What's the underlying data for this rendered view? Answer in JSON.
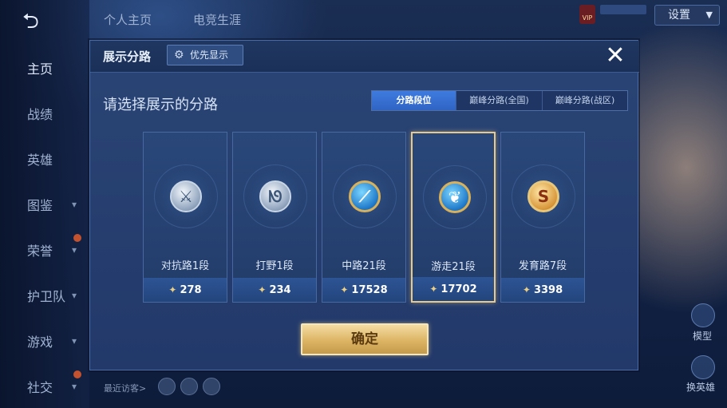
{
  "background": {
    "top_tabs": [
      "个人主页",
      "电竞生涯"
    ],
    "settings_label": "设置",
    "vip_text": "VIP",
    "nav_items": [
      {
        "label": "主页",
        "active": true,
        "has_chevron": false,
        "has_dot": false
      },
      {
        "label": "战绩",
        "active": false,
        "has_chevron": false,
        "has_dot": false
      },
      {
        "label": "英雄",
        "active": false,
        "has_chevron": false,
        "has_dot": false
      },
      {
        "label": "图鉴",
        "active": false,
        "has_chevron": true,
        "has_dot": false
      },
      {
        "label": "荣誉",
        "active": false,
        "has_chevron": true,
        "has_dot": true
      },
      {
        "label": "护卫队",
        "active": false,
        "has_chevron": true,
        "has_dot": false
      },
      {
        "label": "游戏",
        "active": false,
        "has_chevron": true,
        "has_dot": false
      },
      {
        "label": "社交",
        "active": false,
        "has_chevron": true,
        "has_dot": true
      }
    ],
    "recent_visitors_label": "最近访客>",
    "right_labels": {
      "model": "模型",
      "change_hero": "换英雄"
    }
  },
  "modal": {
    "title": "展示分路",
    "priority_button": "优先显示",
    "subtitle": "请选择展示的分路",
    "tabs": [
      {
        "label": "分路段位",
        "active": true
      },
      {
        "label": "巅峰分路(全国)",
        "active": false
      },
      {
        "label": "巅峰分路(战区)",
        "active": false
      }
    ],
    "cards": [
      {
        "lane": "对抗路1段",
        "score": "278",
        "emblem": "sword-emblem-icon",
        "style": "silver",
        "glyph": "⚔",
        "selected": false
      },
      {
        "lane": "打野1段",
        "score": "234",
        "emblem": "dragon-emblem-icon",
        "style": "silver",
        "glyph": "ᘚ",
        "selected": false
      },
      {
        "lane": "中路21段",
        "score": "17528",
        "emblem": "staff-emblem-icon",
        "style": "gold-blue",
        "glyph": "⟋",
        "selected": false
      },
      {
        "lane": "游走21段",
        "score": "17702",
        "emblem": "wings-emblem-icon",
        "style": "gold-blue",
        "glyph": "❦",
        "selected": true
      },
      {
        "lane": "发育路7段",
        "score": "3398",
        "emblem": "bow-emblem-icon",
        "style": "gold",
        "glyph": "S",
        "selected": false
      }
    ],
    "confirm_button": "确定"
  },
  "colors": {
    "accent_blue": "#3f7be0",
    "selected_border": "#e7c98a",
    "confirm_gold": "#dcb464"
  }
}
